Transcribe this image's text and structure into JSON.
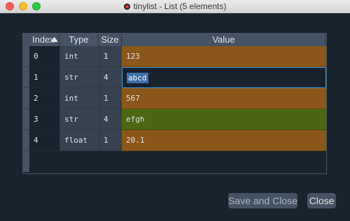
{
  "window": {
    "title": "tinylist - List (5 elements)"
  },
  "table": {
    "headers": {
      "index": "Index",
      "type": "Type",
      "size": "Size",
      "value": "Value"
    },
    "rows": [
      {
        "index": "0",
        "type": "int",
        "size": "1",
        "value": "123"
      },
      {
        "index": "1",
        "type": "str",
        "size": "4",
        "value": "abcd"
      },
      {
        "index": "2",
        "type": "int",
        "size": "1",
        "value": "567"
      },
      {
        "index": "3",
        "type": "str",
        "size": "4",
        "value": "efgh"
      },
      {
        "index": "4",
        "type": "float",
        "size": "1",
        "value": "20.1"
      }
    ]
  },
  "buttons": {
    "save_close": "Save and Close",
    "close": "Close"
  },
  "colors": {
    "background": "#19232d",
    "int_float_value": "#8a561a",
    "str_value": "#4c6613",
    "editor_border": "#3d9ee2"
  }
}
